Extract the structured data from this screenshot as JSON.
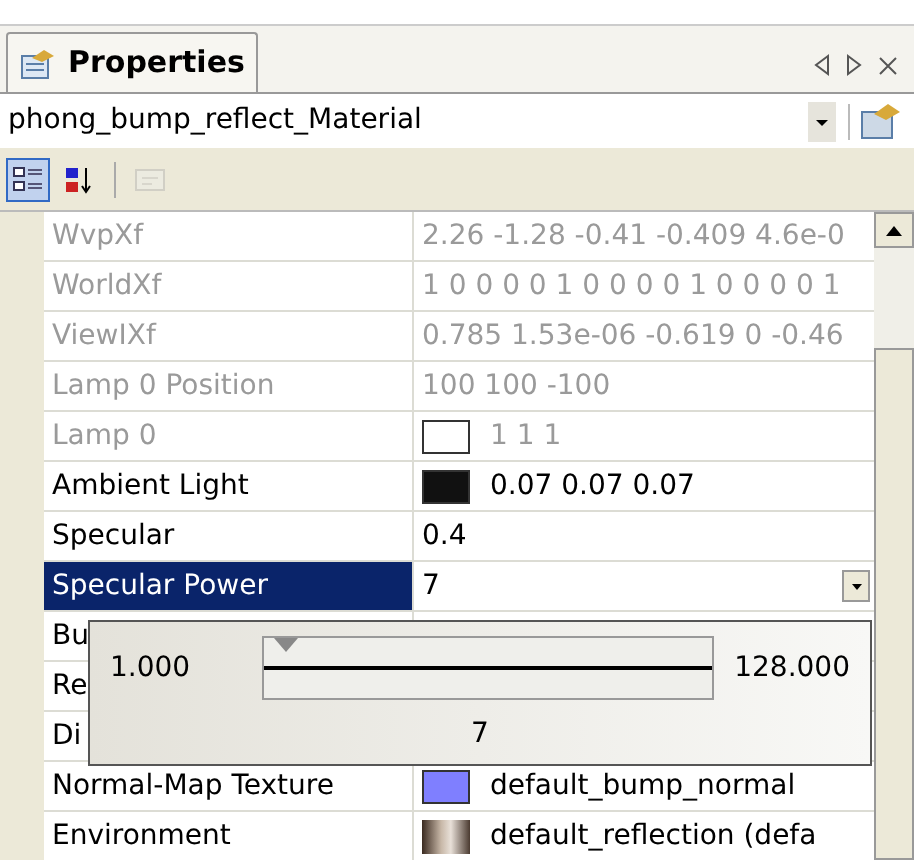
{
  "panel": {
    "tab": "Properties",
    "selector": "phong_bump_reflect_Material"
  },
  "toolbar": [
    {
      "kind": "categorized",
      "selected": true
    },
    {
      "kind": "alphabetical",
      "selected": false
    },
    {
      "kind": "pages",
      "selected": false,
      "disabled": true
    }
  ],
  "properties": [
    {
      "name": "WvpXf",
      "kind": "text",
      "value": "2.26 -1.28 -0.41 -0.409 4.6e-0",
      "disabled": true,
      "selected": false
    },
    {
      "name": "WorldXf",
      "kind": "text",
      "value": "1 0 0 0 0 1 0 0 0 0 1 0 0 0 0 1",
      "disabled": true,
      "selected": false
    },
    {
      "name": "ViewIXf",
      "kind": "text",
      "value": "0.785 1.53e-06 -0.619 0 -0.46",
      "disabled": true,
      "selected": false
    },
    {
      "name": "Lamp 0 Position",
      "kind": "text",
      "value": "100 100 -100",
      "disabled": true,
      "selected": false
    },
    {
      "name": "Lamp 0",
      "kind": "color",
      "color": "#ffffff",
      "value": "1 1 1",
      "disabled": true,
      "selected": false
    },
    {
      "name": "Ambient Light",
      "kind": "color",
      "color": "#111111",
      "value": "0.07 0.07 0.07",
      "disabled": false,
      "selected": false
    },
    {
      "name": "Specular",
      "kind": "text",
      "value": "0.4",
      "disabled": false,
      "selected": false
    },
    {
      "name": "Specular Power",
      "kind": "dropdown",
      "value": "7",
      "disabled": false,
      "selected": true
    },
    {
      "name": "Bu",
      "kind": "text",
      "disabled": false,
      "selected": false
    },
    {
      "name": "Re",
      "kind": "text",
      "disabled": false,
      "selected": false
    },
    {
      "name": "Di",
      "kind": "text",
      "disabled": false,
      "selected": false
    },
    {
      "name": "Normal-Map Texture",
      "kind": "color",
      "color": "#7f7fff",
      "value": "default_bump_normal",
      "disabled": false,
      "selected": false
    },
    {
      "name": "Environment",
      "kind": "texture",
      "value": "default_reflection (defa",
      "disabled": false,
      "selected": false
    }
  ],
  "slider_popup": {
    "min": "1.000",
    "max": "128.000",
    "level": 0.047,
    "reading": "7"
  }
}
